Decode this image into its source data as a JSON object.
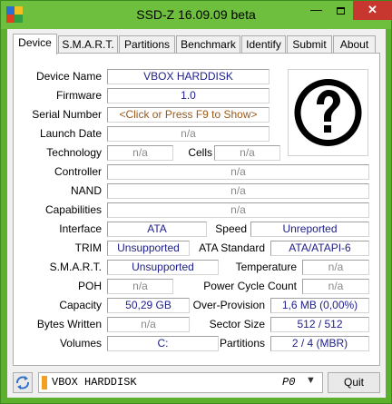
{
  "window": {
    "title": "SSD-Z 16.09.09 beta",
    "close_glyph": "✕",
    "minimize_glyph": "—",
    "accent": "#5cb02e"
  },
  "tabs": [
    {
      "label": "Device",
      "active": true
    },
    {
      "label": "S.M.A.R.T."
    },
    {
      "label": "Partitions"
    },
    {
      "label": "Benchmark"
    },
    {
      "label": "Identify"
    },
    {
      "label": "Submit"
    },
    {
      "label": "About"
    }
  ],
  "device": {
    "device_name": {
      "label": "Device Name",
      "value": "VBOX HARDDISK"
    },
    "firmware": {
      "label": "Firmware",
      "value": "1.0"
    },
    "serial": {
      "label": "Serial Number",
      "value": "<Click or Press F9 to Show>"
    },
    "launch_date": {
      "label": "Launch Date",
      "value": "n/a"
    },
    "technology": {
      "label": "Technology",
      "value": "n/a"
    },
    "cells": {
      "label": "Cells",
      "value": "n/a"
    },
    "controller": {
      "label": "Controller",
      "value": "n/a"
    },
    "nand": {
      "label": "NAND",
      "value": "n/a"
    },
    "capabilities": {
      "label": "Capabilities",
      "value": "n/a"
    },
    "interface": {
      "label": "Interface",
      "value": "ATA"
    },
    "speed": {
      "label": "Speed",
      "value": "Unreported"
    },
    "trim": {
      "label": "TRIM",
      "value": "Unsupported"
    },
    "ata_standard": {
      "label": "ATA Standard",
      "value": "ATA/ATAPI-6"
    },
    "smart": {
      "label": "S.M.A.R.T.",
      "value": "Unsupported"
    },
    "temperature": {
      "label": "Temperature",
      "value": "n/a"
    },
    "poh": {
      "label": "POH",
      "value": "n/a"
    },
    "power_cycle": {
      "label": "Power Cycle Count",
      "value": "n/a"
    },
    "capacity": {
      "label": "Capacity",
      "value": "50,29 GB"
    },
    "over_provision": {
      "label": "Over-Provision",
      "value": "1,6 MB (0,00%)"
    },
    "bytes_written": {
      "label": "Bytes Written",
      "value": "n/a"
    },
    "sector_size": {
      "label": "Sector Size",
      "value": "512 / 512"
    },
    "volumes": {
      "label": "Volumes",
      "value": "C:"
    },
    "partitions": {
      "label": "Partitions",
      "value": "2 / 4 (MBR)"
    },
    "logo_glyph": "?"
  },
  "footer": {
    "drive_name": "VBOX HARDDISK",
    "drive_port": "P0",
    "drive_arrow": "▼",
    "quit_label": "Quit",
    "refresh_icon": "refresh-icon"
  }
}
